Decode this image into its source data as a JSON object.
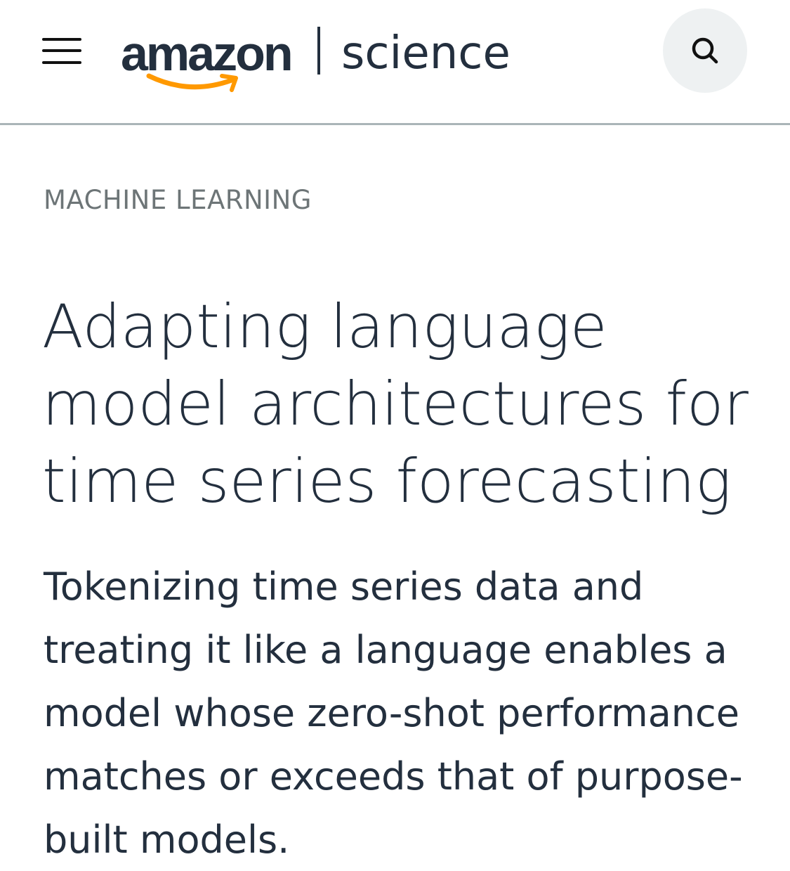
{
  "header": {
    "logo": {
      "brand": "amazon",
      "section": "science"
    },
    "menu_icon": "hamburger-menu-icon",
    "search_icon": "search-icon"
  },
  "article": {
    "category": "MACHINE LEARNING",
    "title_lines": [
      "Adapting language",
      "model architectures for",
      "time series forecasting"
    ],
    "summary_lines": [
      "Tokenizing time series data and",
      "treating it like a language enables a",
      "model whose zero-shot performance",
      "matches or exceeds that of purpose-",
      "built models."
    ]
  },
  "colors": {
    "text": "#232f3e",
    "category": "#6d7577",
    "smile": "#ff9900",
    "divider_line": "#aab5b8",
    "search_bg": "#eef1f2"
  }
}
